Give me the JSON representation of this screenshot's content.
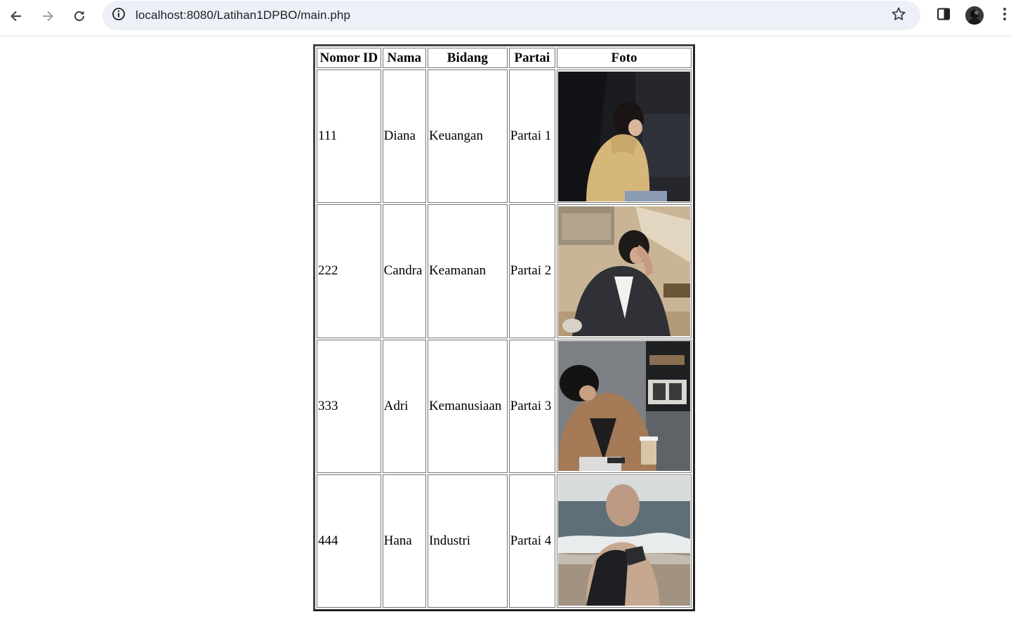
{
  "browser": {
    "url": "localhost:8080/Latihan1DPBO/main.php"
  },
  "icons": {
    "back": "back-arrow-icon",
    "forward": "forward-arrow-icon",
    "reload": "reload-icon",
    "site_info": "info-icon",
    "bookmark": "star-icon",
    "side_panel": "side-panel-icon",
    "menu": "kebab-menu-icon"
  },
  "table": {
    "headers": [
      "Nomor ID",
      "Nama",
      "Bidang",
      "Partai",
      "Foto"
    ],
    "rows": [
      {
        "id": "111",
        "nama": "Diana",
        "bidang": "Keuangan",
        "partai": "Partai 1",
        "foto": "photo-woman-in-car"
      },
      {
        "id": "222",
        "nama": "Candra",
        "bidang": "Keamanan",
        "partai": "Partai 2",
        "foto": "photo-man-with-hand-on-head"
      },
      {
        "id": "333",
        "nama": "Adri",
        "bidang": "Kemanusiaan",
        "partai": "Partai 3",
        "foto": "photo-man-with-phone-and-coffee"
      },
      {
        "id": "444",
        "nama": "Hana",
        "bidang": "Industri",
        "partai": "Partai 4",
        "foto": "photo-woman-at-beach"
      }
    ]
  }
}
